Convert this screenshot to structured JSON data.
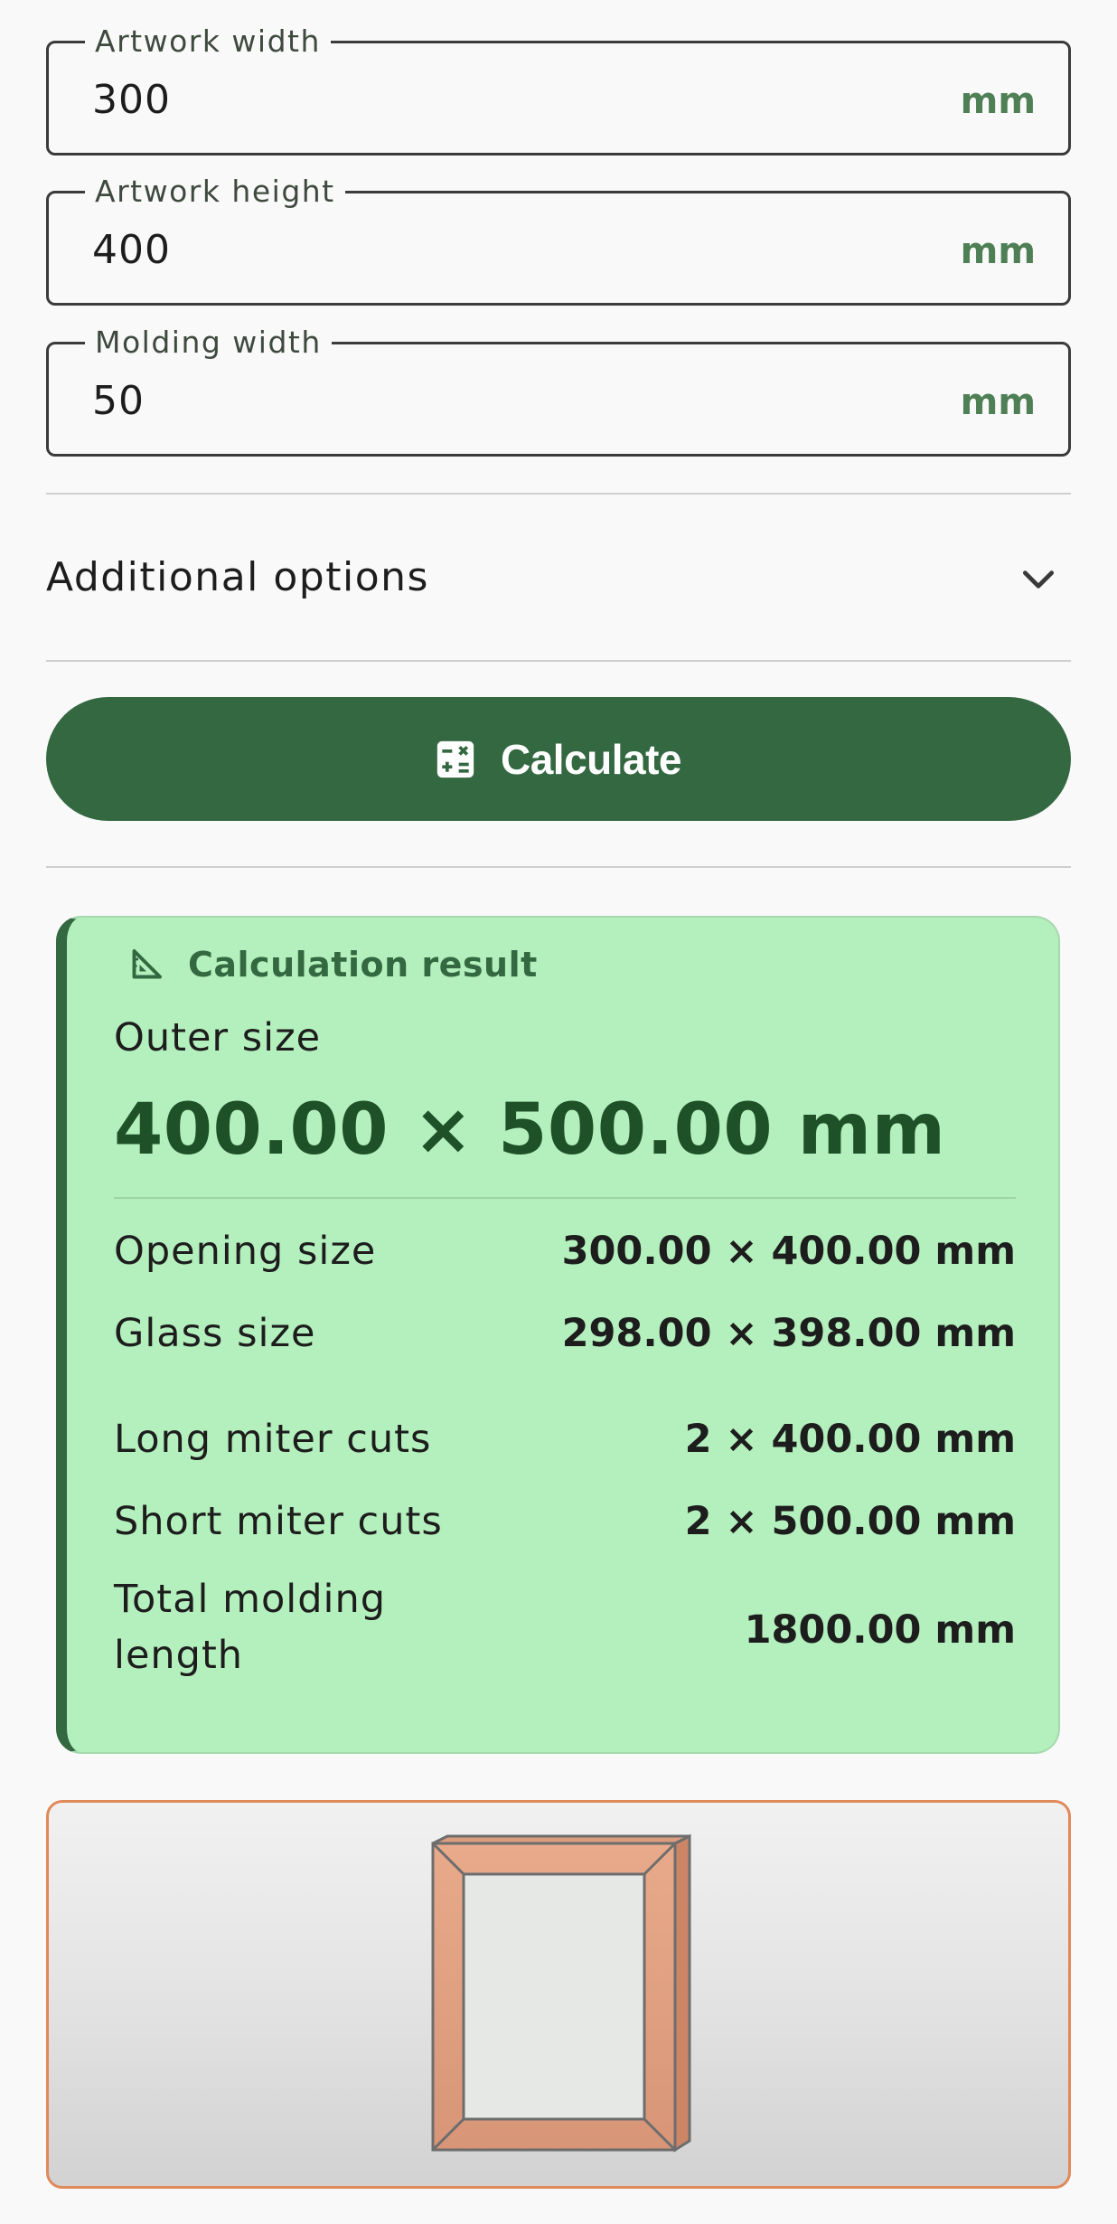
{
  "fields": [
    {
      "label": "Artwork width",
      "value": "300",
      "unit": "mm"
    },
    {
      "label": "Artwork height",
      "value": "400",
      "unit": "mm"
    },
    {
      "label": "Molding width",
      "value": "50",
      "unit": "mm"
    }
  ],
  "additional_options": {
    "label": "Additional options",
    "icon": "chevron-down-icon"
  },
  "calculate_button": {
    "label": "Calculate",
    "icon": "calculator-icon"
  },
  "result": {
    "title": "Calculation result",
    "icon": "set-square-icon",
    "outer_label": "Outer size",
    "outer_value": "400.00 × 500.00 mm",
    "rows": [
      {
        "label": "Opening size",
        "value": "300.00 × 400.00 mm"
      },
      {
        "label": "Glass size",
        "value": "298.00 × 398.00 mm"
      },
      {
        "label": "Long miter cuts",
        "value": "2 × 400.00 mm"
      },
      {
        "label": "Short miter cuts",
        "value": "2 × 500.00 mm"
      },
      {
        "label": "Total molding length",
        "value": "1800.00 mm"
      }
    ]
  },
  "colors": {
    "accent": "#336841",
    "result_bg": "#b4f0bd",
    "unit_text": "#4f7f55",
    "frame": "#e3a07f",
    "preview_border": "#e0895a"
  }
}
